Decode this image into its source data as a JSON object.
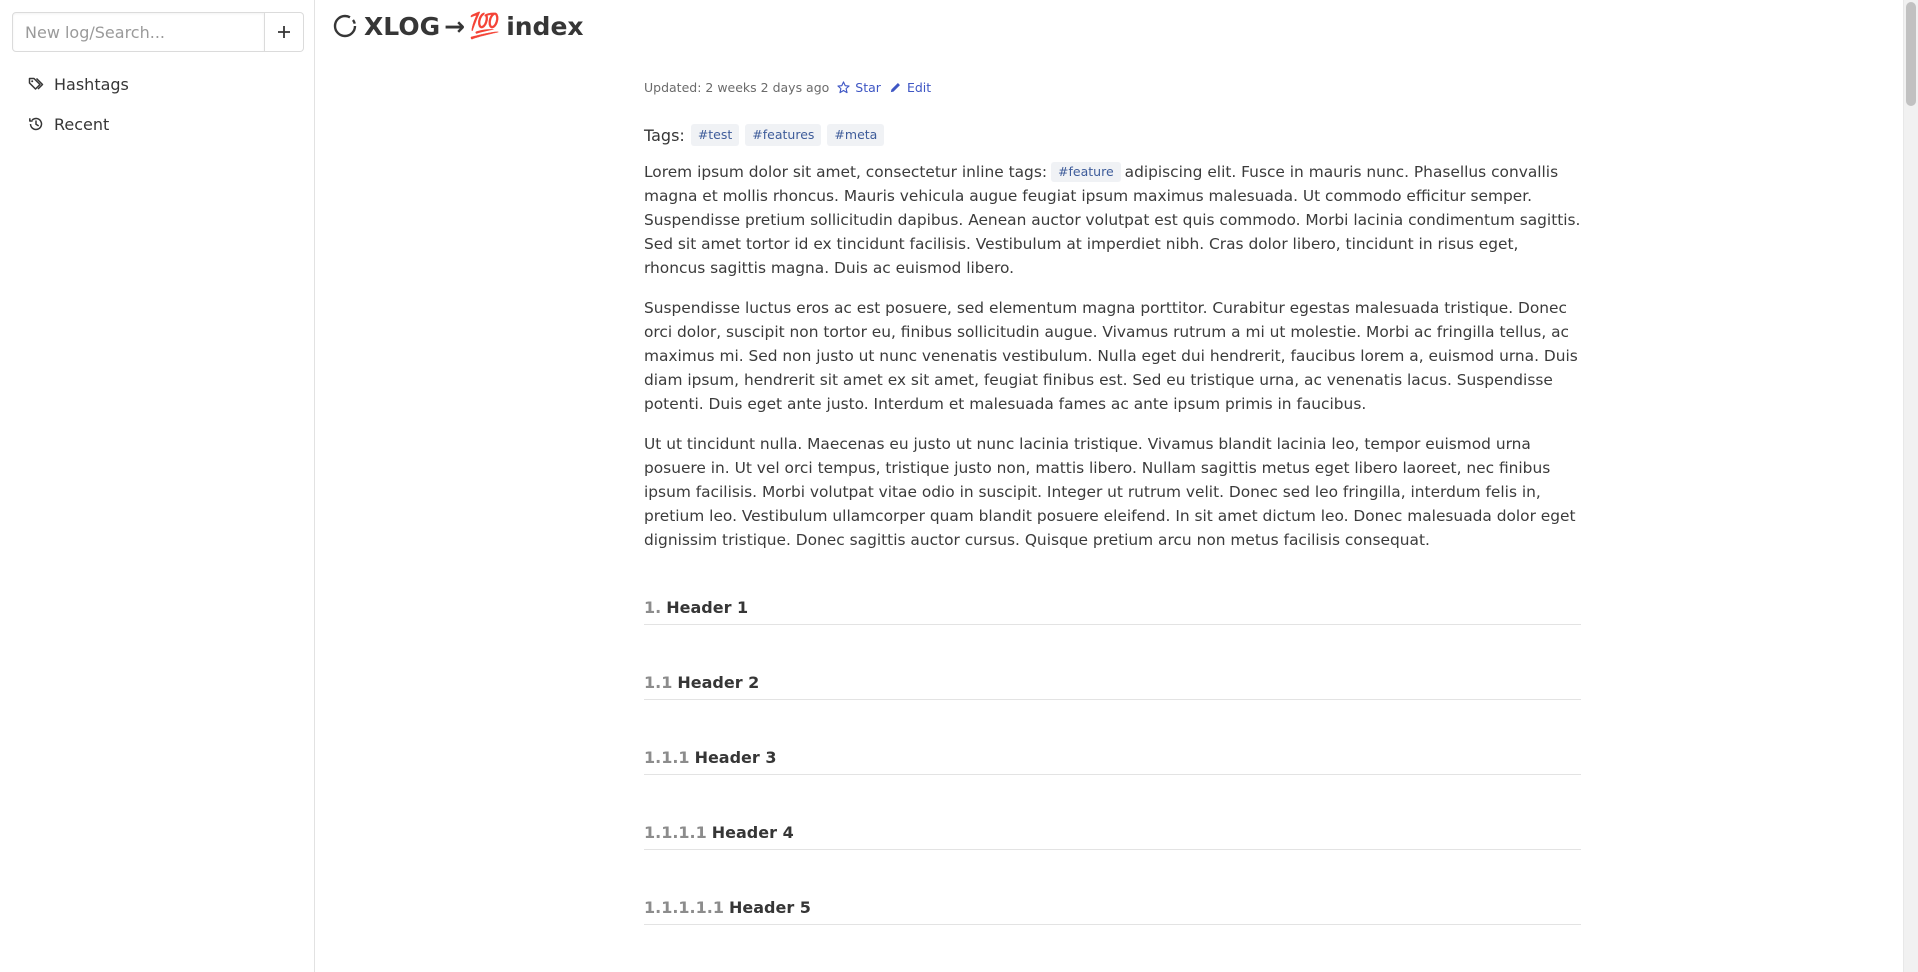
{
  "sidebar": {
    "search": {
      "placeholder": "New log/Search...",
      "value": ""
    },
    "add_label": "+",
    "items": [
      {
        "label": "Hashtags",
        "icon": "tags-icon"
      },
      {
        "label": "Recent",
        "icon": "history-icon"
      }
    ]
  },
  "header": {
    "app_name": "XLOG",
    "arrow": "→",
    "page_icon": "💯",
    "page_name": "index"
  },
  "meta": {
    "updated": "Updated: 2 weeks 2 days ago",
    "star_label": "Star",
    "edit_label": "Edit"
  },
  "tags": {
    "label": "Tags:",
    "items": [
      "#test",
      "#features",
      "#meta"
    ]
  },
  "paragraphs": {
    "p1_before": "Lorem ipsum dolor sit amet, consectetur inline tags:",
    "p1_tag": "#feature",
    "p1_after": "adipiscing elit. Fusce in mauris nunc. Phasellus convallis magna et mollis rhoncus. Mauris vehicula augue feugiat ipsum maximus malesuada. Ut commodo efficitur semper. Suspendisse pretium sollicitudin dapibus. Aenean auctor volutpat est quis commodo. Morbi lacinia condimentum sagittis. Sed sit amet tortor id ex tincidunt facilisis. Vestibulum at imperdiet nibh. Cras dolor libero, tincidunt in risus eget, rhoncus sagittis magna. Duis ac euismod libero.",
    "p2": "Suspendisse luctus eros ac est posuere, sed elementum magna porttitor. Curabitur egestas malesuada tristique. Donec orci dolor, suscipit non tortor eu, finibus sollicitudin augue. Vivamus rutrum a mi ut molestie. Morbi ac fringilla tellus, ac maximus mi. Sed non justo ut nunc venenatis vestibulum. Nulla eget dui hendrerit, faucibus lorem a, euismod urna. Duis diam ipsum, hendrerit sit amet ex sit amet, feugiat finibus est. Sed eu tristique urna, ac venenatis lacus. Suspendisse potenti. Duis eget ante justo. Interdum et malesuada fames ac ante ipsum primis in faucibus.",
    "p3": "Ut ut tincidunt nulla. Maecenas eu justo ut nunc lacinia tristique. Vivamus blandit lacinia leo, tempor euismod urna posuere in. Ut vel orci tempus, tristique justo non, mattis libero. Nullam sagittis metus eget libero laoreet, nec finibus ipsum facilisis. Morbi volutpat vitae odio in suscipit. Integer ut rutrum velit. Donec sed leo fringilla, interdum felis in, pretium leo. Vestibulum ullamcorper quam blandit posuere eleifend. In sit amet dictum leo. Donec malesuada dolor eget dignissim tristique. Donec sagittis auctor cursus. Quisque pretium arcu non metus facilisis consequat."
  },
  "headings": [
    {
      "num": "1.",
      "text": "Header 1"
    },
    {
      "num": "1.1",
      "text": "Header 2"
    },
    {
      "num": "1.1.1",
      "text": "Header 3"
    },
    {
      "num": "1.1.1.1",
      "text": "Header 4"
    },
    {
      "num": "1.1.1.1.1",
      "text": "Header 5"
    }
  ],
  "colors": {
    "link": "#3e56c4",
    "tag_bg": "#f0f2f5",
    "tag_text": "#3e5c9a",
    "text": "#363636"
  }
}
